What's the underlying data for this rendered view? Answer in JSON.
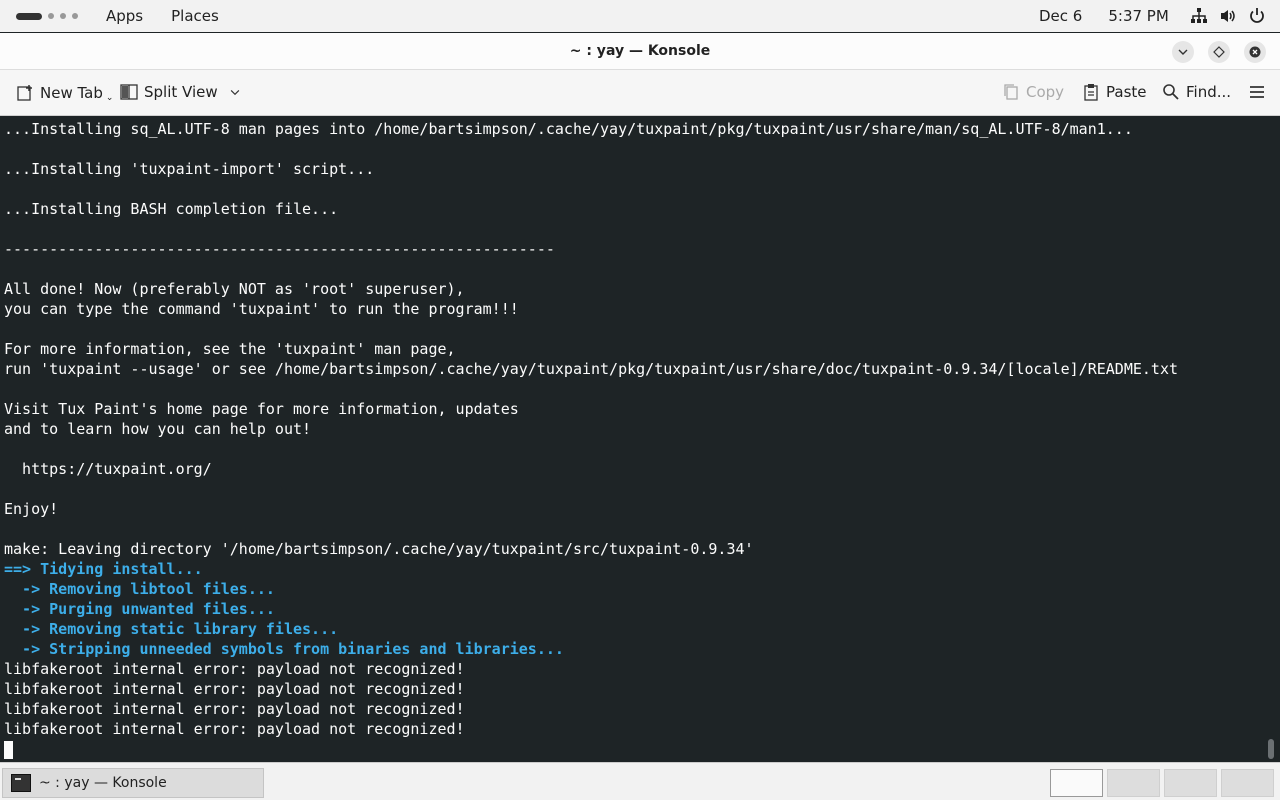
{
  "top_panel": {
    "apps_label": "Apps",
    "places_label": "Places",
    "date": "Dec 6",
    "time": "5:37 PM",
    "tray_icons": [
      "network-icon",
      "volume-icon",
      "power-icon"
    ]
  },
  "window": {
    "title": "~ : yay — Konsole"
  },
  "toolbar": {
    "new_tab_label": "New Tab",
    "split_view_label": "Split View",
    "copy_label": "Copy",
    "paste_label": "Paste",
    "find_label": "Find..."
  },
  "terminal": {
    "lines": [
      {
        "text": "...Installing sq_AL.UTF-8 man pages into /home/bartsimpson/.cache/yay/tuxpaint/pkg/tuxpaint/usr/share/man/sq_AL.UTF-8/man1...",
        "style": "normal"
      },
      {
        "text": "",
        "style": "normal"
      },
      {
        "text": "...Installing 'tuxpaint-import' script...",
        "style": "normal"
      },
      {
        "text": "",
        "style": "normal"
      },
      {
        "text": "...Installing BASH completion file...",
        "style": "normal"
      },
      {
        "text": "",
        "style": "normal"
      },
      {
        "text": "-------------------------------------------------------------",
        "style": "normal"
      },
      {
        "text": "",
        "style": "normal"
      },
      {
        "text": "All done! Now (preferably NOT as 'root' superuser),",
        "style": "normal"
      },
      {
        "text": "you can type the command 'tuxpaint' to run the program!!!",
        "style": "normal"
      },
      {
        "text": "",
        "style": "normal"
      },
      {
        "text": "For more information, see the 'tuxpaint' man page,",
        "style": "normal"
      },
      {
        "text": "run 'tuxpaint --usage' or see /home/bartsimpson/.cache/yay/tuxpaint/pkg/tuxpaint/usr/share/doc/tuxpaint-0.9.34/[locale]/README.txt",
        "style": "normal"
      },
      {
        "text": "",
        "style": "normal"
      },
      {
        "text": "Visit Tux Paint's home page for more information, updates",
        "style": "normal"
      },
      {
        "text": "and to learn how you can help out!",
        "style": "normal"
      },
      {
        "text": "",
        "style": "normal"
      },
      {
        "text": "  https://tuxpaint.org/",
        "style": "normal"
      },
      {
        "text": "",
        "style": "normal"
      },
      {
        "text": "Enjoy!",
        "style": "normal"
      },
      {
        "text": "",
        "style": "normal"
      },
      {
        "text": "make: Leaving directory '/home/bartsimpson/.cache/yay/tuxpaint/src/tuxpaint-0.9.34'",
        "style": "normal"
      },
      {
        "text": "==> Tidying install...",
        "style": "blue"
      },
      {
        "text": "  -> Removing libtool files...",
        "style": "blue"
      },
      {
        "text": "  -> Purging unwanted files...",
        "style": "blue"
      },
      {
        "text": "  -> Removing static library files...",
        "style": "blue"
      },
      {
        "text": "  -> Stripping unneeded symbols from binaries and libraries...",
        "style": "blue"
      },
      {
        "text": "libfakeroot internal error: payload not recognized!",
        "style": "normal"
      },
      {
        "text": "libfakeroot internal error: payload not recognized!",
        "style": "normal"
      },
      {
        "text": "libfakeroot internal error: payload not recognized!",
        "style": "normal"
      },
      {
        "text": "libfakeroot internal error: payload not recognized!",
        "style": "normal"
      }
    ]
  },
  "taskbar": {
    "task_label": "~ : yay — Konsole",
    "workspaces": 4,
    "active_workspace": 1
  },
  "colors": {
    "terminal_bg": "#1e2426",
    "terminal_fg": "#fcfcfc",
    "accent_blue": "#3daee9"
  }
}
